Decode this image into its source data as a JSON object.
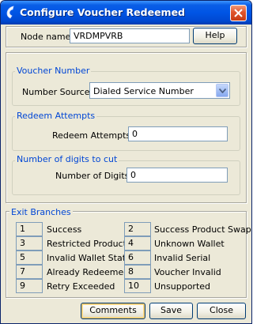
{
  "window": {
    "title": "Configure Voucher Redeemed"
  },
  "node": {
    "label": "Node name",
    "value": "VRDMPVRB",
    "help_label": "Help"
  },
  "voucher_number": {
    "legend": "Voucher Number",
    "source_label": "Number Source",
    "source_value": "Dialed Service Number"
  },
  "redeem_attempts": {
    "legend": "Redeem Attempts",
    "label": "Redeem Attempts",
    "value": "0"
  },
  "digits_to_cut": {
    "legend": "Number of digits to cut",
    "label": "Number of Digits",
    "value": "0"
  },
  "exit_branches": {
    "legend": "Exit Branches",
    "items": [
      {
        "num": "1",
        "label": "Success"
      },
      {
        "num": "2",
        "label": "Success Product Swap"
      },
      {
        "num": "3",
        "label": "Restricted Product"
      },
      {
        "num": "4",
        "label": "Unknown Wallet"
      },
      {
        "num": "5",
        "label": "Invalid Wallet State"
      },
      {
        "num": "6",
        "label": "Invalid Serial"
      },
      {
        "num": "7",
        "label": "Already Redeemed"
      },
      {
        "num": "8",
        "label": "Voucher Invalid"
      },
      {
        "num": "9",
        "label": "Retry Exceeded"
      },
      {
        "num": "10",
        "label": "Unsupported"
      }
    ]
  },
  "footer": {
    "comments_label": "Comments",
    "save_label": "Save",
    "close_label": "Close"
  },
  "colors": {
    "titlebar": "#0055e5",
    "legend_text": "#0046d5",
    "dialog_bg": "#ece9d8"
  }
}
